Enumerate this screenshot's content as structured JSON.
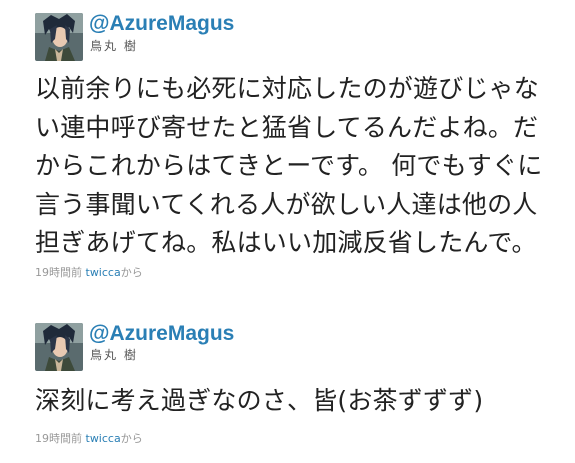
{
  "tweets": [
    {
      "screen_name": "@AzureMagus",
      "real_name": "鳥丸 樹",
      "text": "以前余りにも必死に対応したのが遊びじゃな\nい連中呼び寄せたと猛省してるんだよね。だ\nからこれからはてきとーです。 何でもすぐに\n言う事聞いてくれる人が欲しい人達は他の人\n担ぎあげてね。私はいい加減反省したんで。",
      "time": "19時間前",
      "source": "twicca",
      "via_suffix": "から"
    },
    {
      "screen_name": "@AzureMagus",
      "real_name": "鳥丸 樹",
      "text": "深刻に考え過ぎなのさ、皆(お茶ずずず)",
      "time": "19時間前",
      "source": "twicca",
      "via_suffix": "から"
    }
  ],
  "colors": {
    "link": "#2a7fb5",
    "meta": "#999999",
    "body_text": "#222222"
  }
}
